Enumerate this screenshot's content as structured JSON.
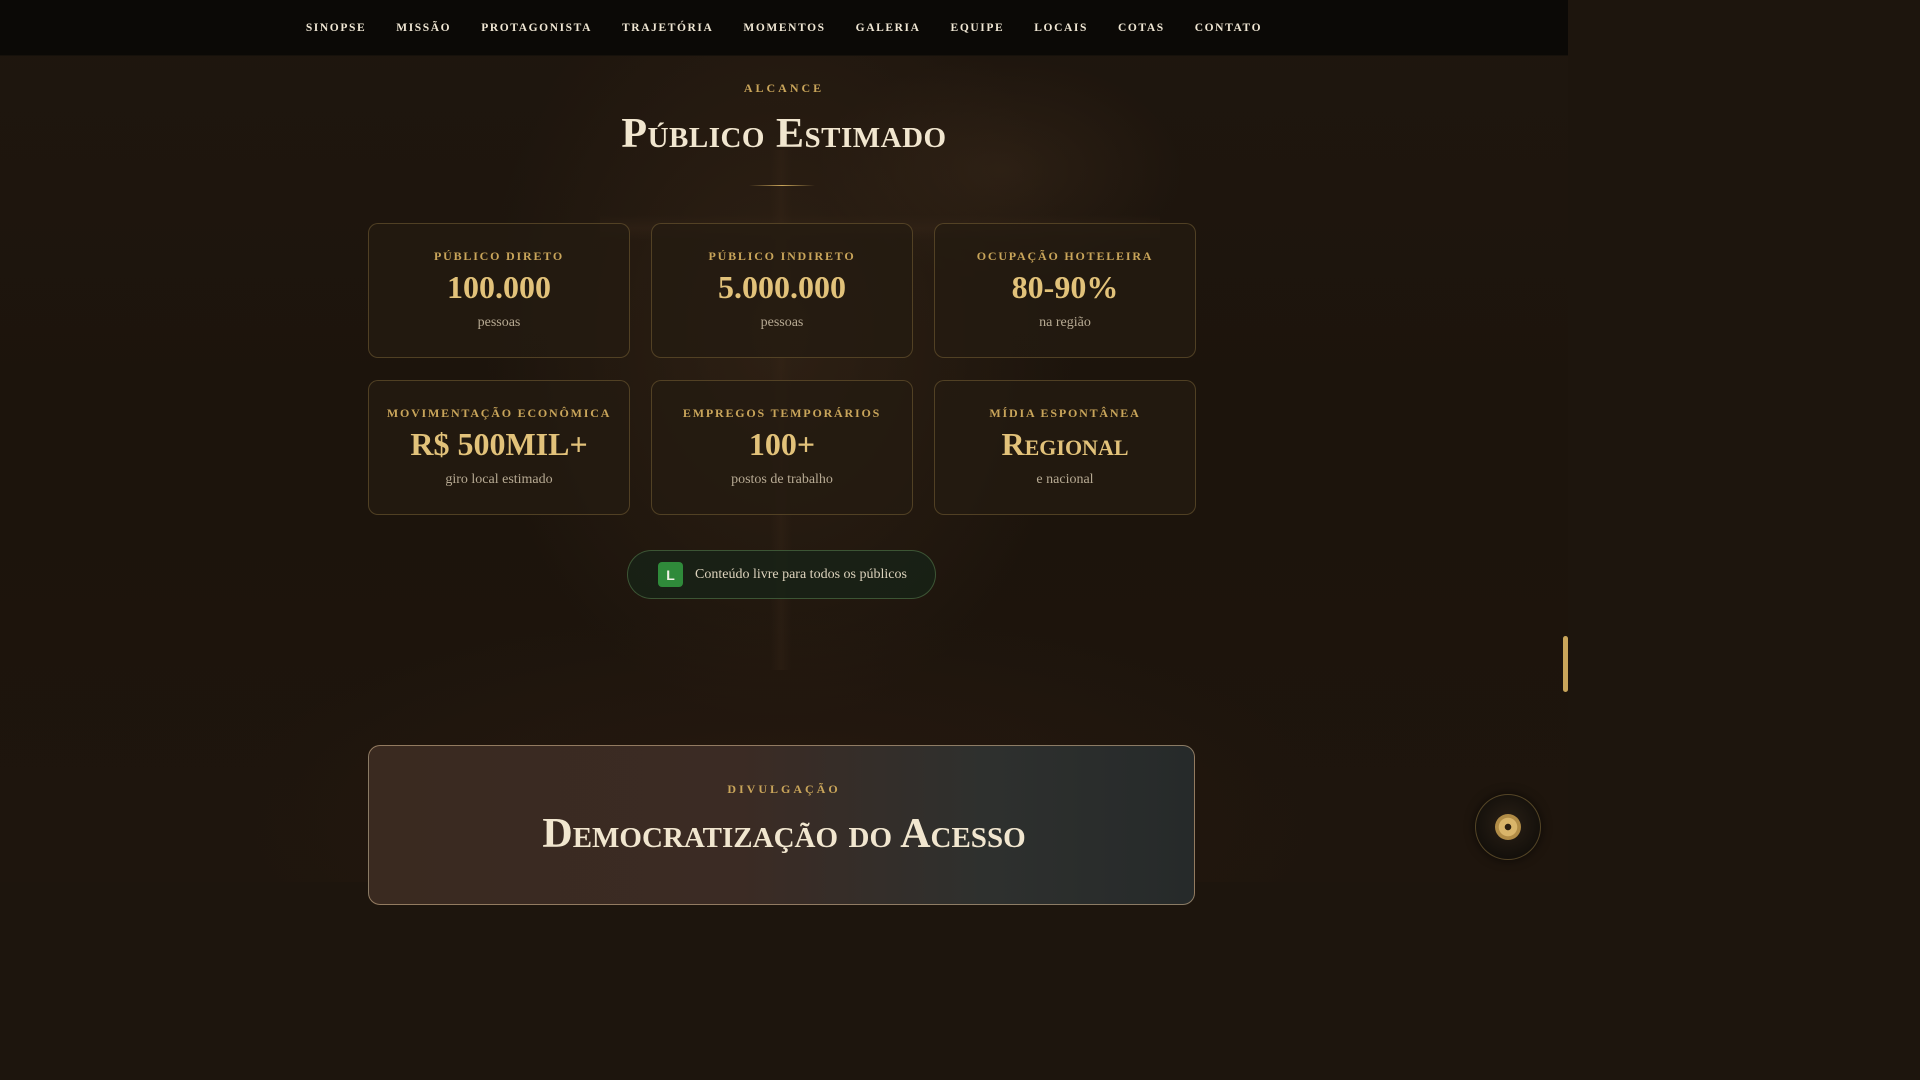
{
  "nav": {
    "items": [
      "SINOPSE",
      "MISSÃO",
      "PROTAGONISTA",
      "TRAJETÓRIA",
      "MOMENTOS",
      "GALERIA",
      "EQUIPE",
      "LOCAIS",
      "COTAS",
      "CONTATO"
    ]
  },
  "section": {
    "eyebrow": "ALCANCE",
    "title": "Público Estimado"
  },
  "cards": [
    {
      "label": "PÚBLICO DIRETO",
      "value": "100.000",
      "sub": "pessoas"
    },
    {
      "label": "PÚBLICO INDIRETO",
      "value": "5.000.000",
      "sub": "pessoas"
    },
    {
      "label": "OCUPAÇÃO HOTELEIRA",
      "value": "80-90%",
      "sub": "na região"
    },
    {
      "label": "MOVIMENTAÇÃO ECONÔMICA",
      "value": "R$ 500MIL+",
      "sub": "giro local estimado"
    },
    {
      "label": "EMPREGOS TEMPORÁRIOS",
      "value": "100+",
      "sub": "postos de trabalho"
    },
    {
      "label": "MÍDIA ESPONTÂNEA",
      "value": "Regional",
      "sub": "e nacional"
    }
  ],
  "rating": {
    "badge": "L",
    "text": "Conteúdo livre para todos os públicos",
    "color": "#2f8a3a"
  },
  "next_section": {
    "eyebrow": "DIVULGAÇÃO",
    "title": "Democratização do Acesso"
  },
  "floating": {
    "icon": "music-disc-icon"
  },
  "colors": {
    "accent": "#c9a55a",
    "value": "#e2c27a",
    "background": "#1d150d"
  }
}
